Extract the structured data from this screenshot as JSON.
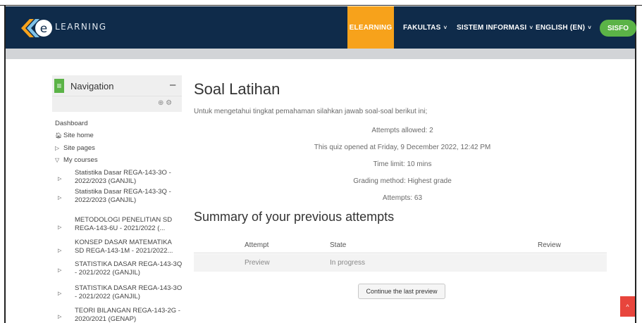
{
  "header": {
    "logo_text": "LEARNING",
    "nav": [
      {
        "label": "ELEARNING"
      },
      {
        "label": "FAKULTAS"
      },
      {
        "label": "SISTEM INFORMASI"
      },
      {
        "label": "ENGLISH (EN)"
      }
    ],
    "sisfo_label": "SISFO",
    "caret": "˅"
  },
  "sidebar": {
    "title": "Navigation",
    "collapse_symbol": "–",
    "tools_symbols": "⊕ ⚙",
    "dashboard": "Dashboard",
    "site_home": "Site home",
    "site_pages": "Site pages",
    "my_courses": "My courses",
    "courses": [
      {
        "line1": "Statistika Dasar REGA-143-3O -",
        "line2": "2022/2023 (GANJIL)"
      },
      {
        "line1": "Statistika Dasar REGA-143-3Q -",
        "line2": "2022/2023 (GANJIL)"
      },
      {
        "line1": "METODOLOGI PENELITIAN SD",
        "line2": "REGA-143-6U - 2021/2022 (..."
      },
      {
        "line1": "KONSEP DASAR MATEMATIKA",
        "line2": "SD REGA-143-1M - 2021/2022..."
      },
      {
        "line1": "STATISTIKA DASAR REGA-143-3Q",
        "line2": "- 2021/2022 (GANJIL)"
      },
      {
        "line1": "STATISTIKA DASAR REGA-143-3O",
        "line2": "- 2021/2022 (GANJIL)"
      },
      {
        "line1": "TEORI BILANGAN REGA-143-2G -",
        "line2": "2020/2021 (GENAP)"
      }
    ]
  },
  "main": {
    "title": "Soal Latihan",
    "intro": "Untuk mengetahui tingkat pemahaman silahkan jawab soal-soal berikut ini;",
    "info": [
      "Attempts allowed: 2",
      "This quiz opened at Friday, 9 December 2022, 12:42 PM",
      "Time limit: 10 mins",
      "Grading method: Highest grade",
      "Attempts: 63"
    ],
    "summary_title": "Summary of your previous attempts",
    "table": {
      "headers": [
        "Attempt",
        "State",
        "Review"
      ],
      "rows": [
        {
          "attempt": "Preview",
          "state": "In progress",
          "review": ""
        }
      ]
    },
    "continue_button": "Continue the last preview"
  },
  "scroll_top_symbol": "^",
  "colors": {
    "navbar": "#0f2b4a",
    "accent_orange": "#f7a21b",
    "accent_green": "#5bb347",
    "scroll_red": "#e8453c"
  }
}
